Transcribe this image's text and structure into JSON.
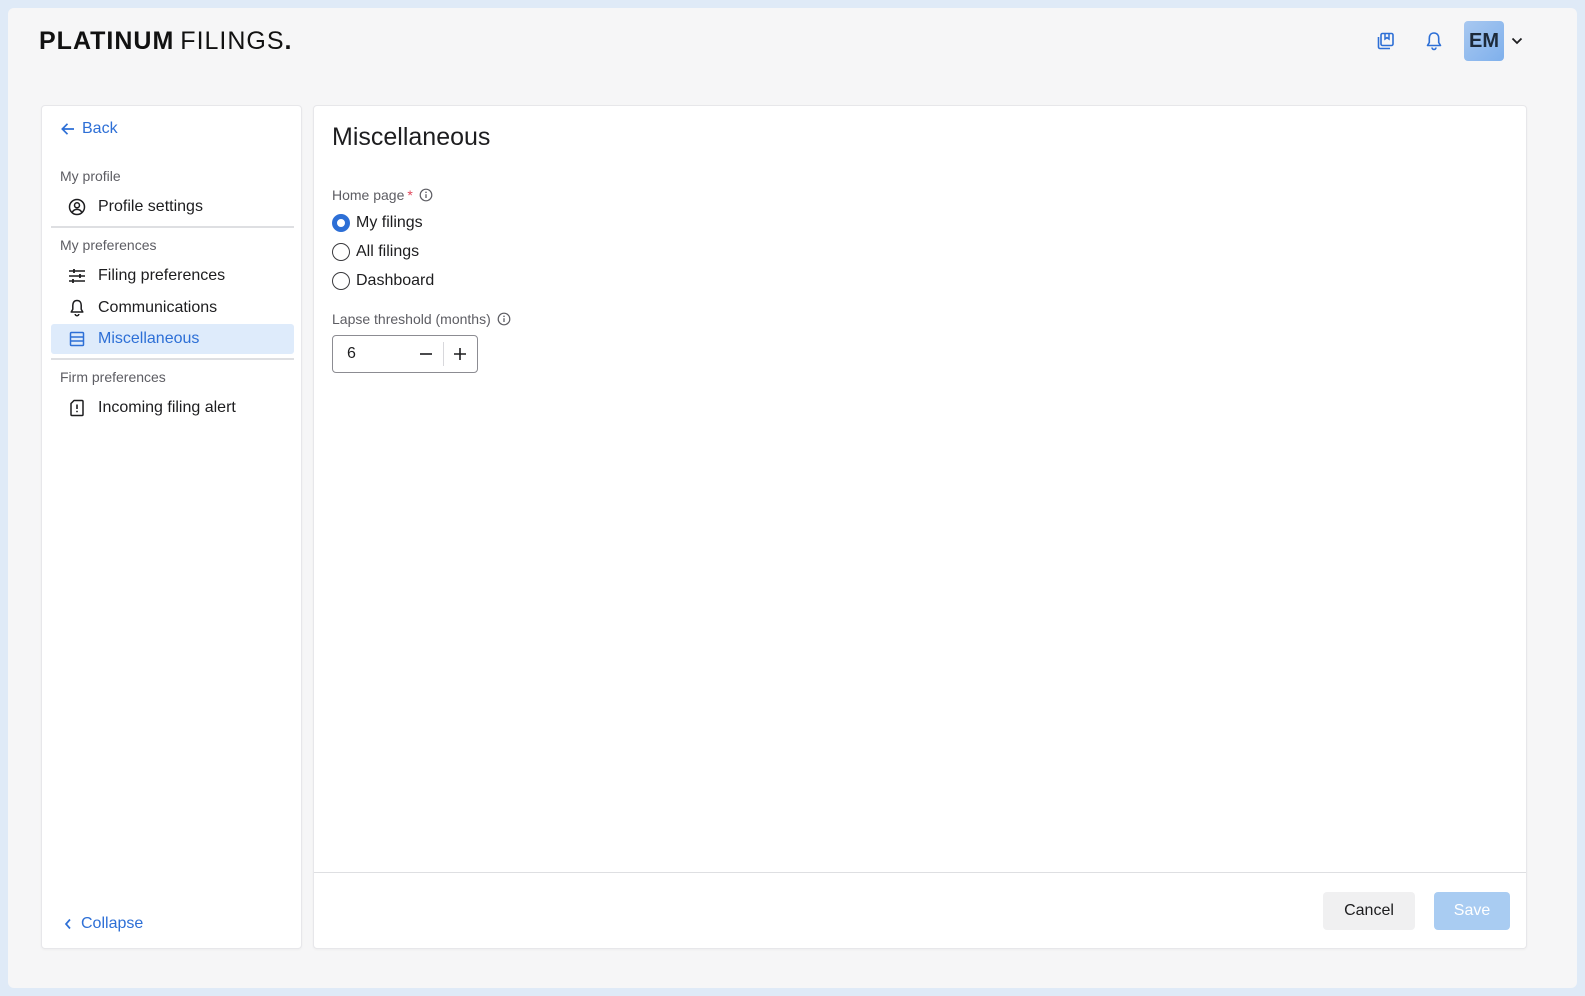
{
  "brand": {
    "bold": "PLATINUM",
    "light": "FILINGS",
    "dot": "."
  },
  "header": {
    "avatar_initials": "EM"
  },
  "sidebar": {
    "back_label": "Back",
    "sections": {
      "profile": "My profile",
      "preferences": "My preferences",
      "firm": "Firm preferences"
    },
    "items": {
      "profile_settings": "Profile settings",
      "filing_preferences": "Filing preferences",
      "communications": "Communications",
      "miscellaneous": "Miscellaneous",
      "incoming_filing_alert": "Incoming filing alert"
    },
    "collapse_label": "Collapse"
  },
  "main": {
    "title": "Miscellaneous",
    "home_page": {
      "label": "Home page",
      "required_mark": "*",
      "options": [
        "My filings",
        "All filings",
        "Dashboard"
      ],
      "selected": "My filings"
    },
    "lapse": {
      "label": "Lapse threshold (months)",
      "value": "6"
    },
    "cancel_label": "Cancel",
    "save_label": "Save"
  },
  "colors": {
    "accent": "#2d6fd6",
    "active_bg": "#deebfb",
    "save_disabled": "#a9ccf2",
    "required": "#e0465a"
  }
}
